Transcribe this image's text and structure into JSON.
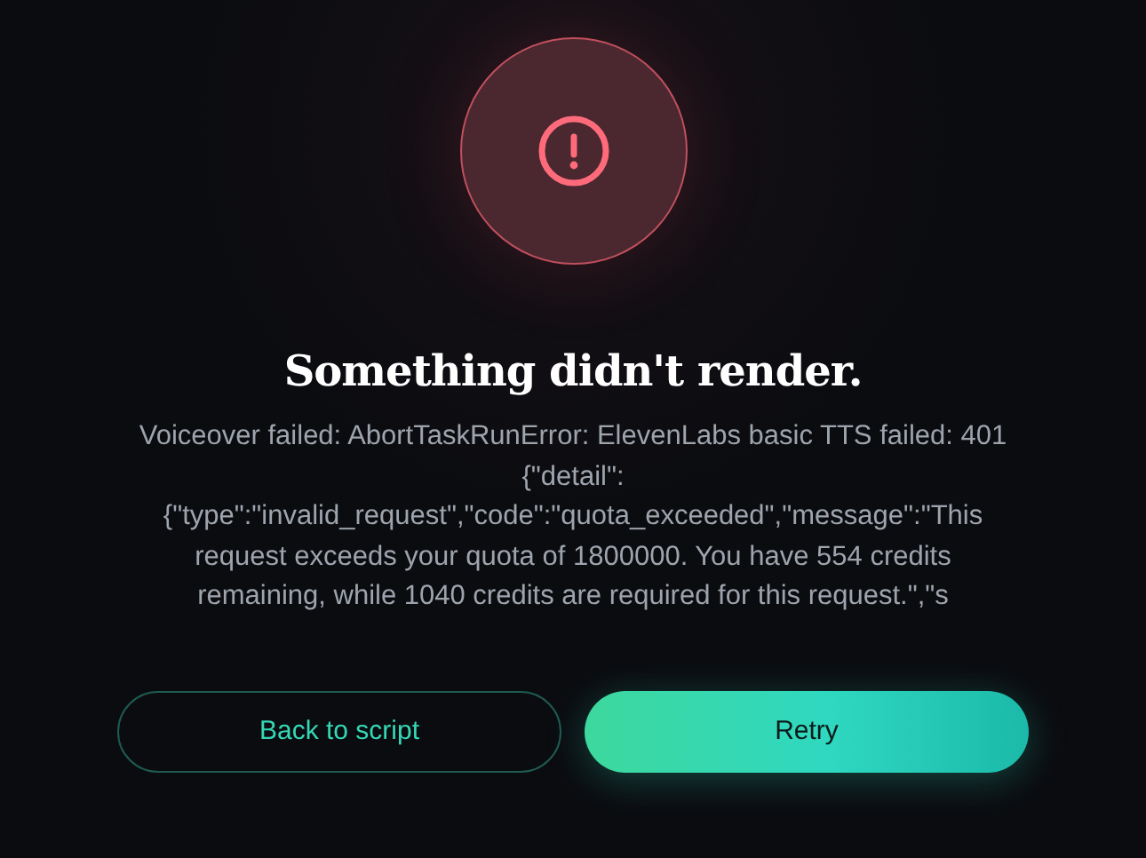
{
  "title": "Something didn't render.",
  "message": "Voiceover failed: AbortTaskRunError: ElevenLabs basic TTS failed: 401 {\"detail\": {\"type\":\"invalid_request\",\"code\":\"quota_exceeded\",\"message\":\"This request exceeds your quota of 1800000. You have 554 credits remaining, while 1040 credits are required for this request.\",\"s",
  "buttons": [
    {
      "label": "Back to script",
      "kind": "secondary"
    },
    {
      "label": "Retry",
      "kind": "primary"
    }
  ]
}
